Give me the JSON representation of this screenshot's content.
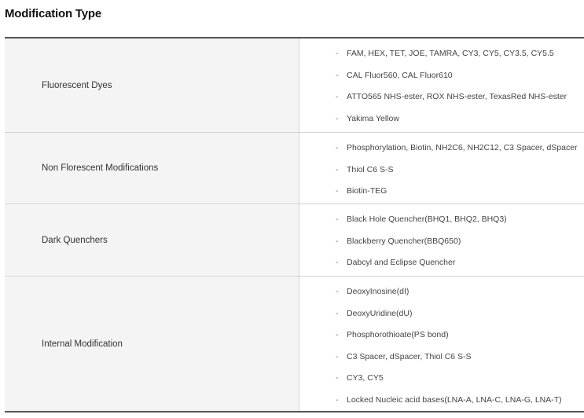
{
  "heading": "Modification Type",
  "rows": [
    {
      "category": "Fluorescent Dyes",
      "items": [
        "FAM, HEX, TET, JOE, TAMRA, CY3, CY5, CY3.5, CY5.5",
        "CAL Fluor560, CAL Fluor610",
        "ATTO565 NHS-ester, ROX NHS-ester, TexasRed NHS-ester",
        "Yakima Yellow"
      ]
    },
    {
      "category": "Non Florescent Modifications",
      "items": [
        "Phosphorylation, Biotin, NH2C6, NH2C12, C3 Spacer, dSpacer",
        "Thiol C6 S-S",
        "Biotin-TEG"
      ]
    },
    {
      "category": "Dark Quenchers",
      "items": [
        "Black Hole Quencher(BHQ1, BHQ2, BHQ3)",
        "Blackberry Quencher(BBQ650)",
        "Dabcyl and Eclipse Quencher"
      ]
    },
    {
      "category": "Internal Modification",
      "items": [
        "DeoxyInosine(dI)",
        "DeoxyUridine(dU)",
        "Phosphorothioate(PS bond)",
        "C3 Spacer, dSpacer, Thiol C6 S-S",
        "CY3, CY5",
        "Locked Nucleic acid bases(LNA-A, LNA-C, LNA-G, LNA-T)"
      ]
    }
  ],
  "bullet": "-"
}
